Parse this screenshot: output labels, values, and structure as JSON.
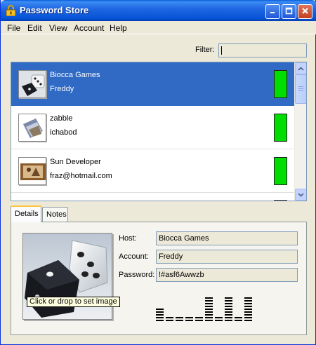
{
  "window": {
    "title": "Password Store"
  },
  "menu": [
    {
      "label": "File"
    },
    {
      "label": "Edit"
    },
    {
      "label": "View"
    },
    {
      "label": "Account"
    },
    {
      "label": "Help"
    }
  ],
  "filter": {
    "label": "Filter:",
    "value": ""
  },
  "entries": [
    {
      "host": "Biocca Games",
      "account": "Freddy",
      "selected": true,
      "strength_color": "#00dd00"
    },
    {
      "host": "zabble",
      "account": "ichabod",
      "selected": false,
      "strength_color": "#00dd00"
    },
    {
      "host": "Sun Developer",
      "account": "fraz@hotmail.com",
      "selected": false,
      "strength_color": "#00dd00"
    }
  ],
  "tabs": [
    {
      "label": "Details",
      "active": true
    },
    {
      "label": "Notes",
      "active": false
    }
  ],
  "details": {
    "tooltip": "Click or drop to set image",
    "host_label": "Host:",
    "host_value": "Biocca Games",
    "account_label": "Account:",
    "account_value": "Freddy",
    "password_label": "Password:",
    "password_value": "!#asf6Awwzb"
  },
  "strength_meter": {
    "columns": [
      0.36,
      0.18,
      0.18,
      0.18,
      0.18,
      0.72,
      0.18,
      0.72,
      0.18,
      0.72
    ]
  },
  "colors": {
    "selection": "#316ac5",
    "strength_good": "#00dd00",
    "titlebar": "#0553d5"
  }
}
